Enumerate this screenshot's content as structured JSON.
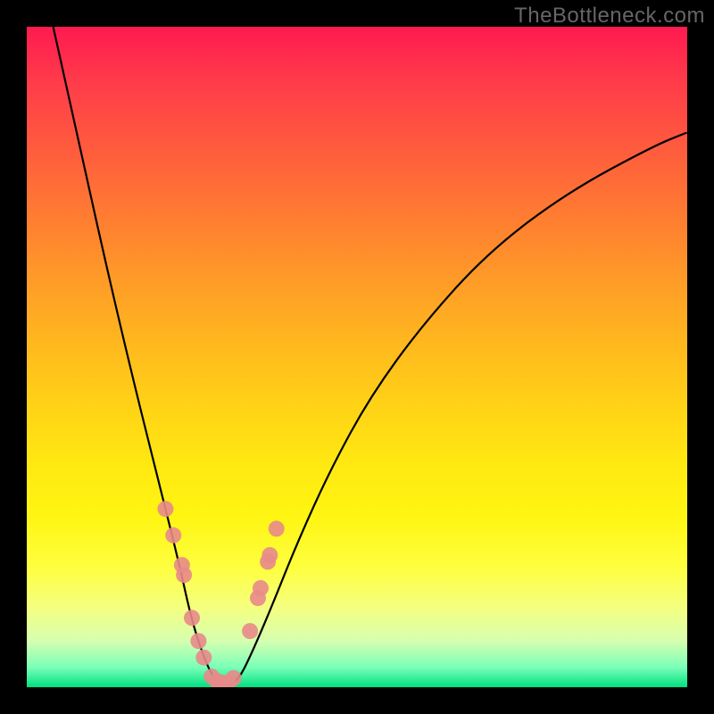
{
  "watermark": "TheBottleneck.com",
  "chart_data": {
    "type": "line",
    "title": "",
    "xlabel": "",
    "ylabel": "",
    "xlim": [
      0,
      100
    ],
    "ylim": [
      0,
      100
    ],
    "background_gradient": [
      "#ff1a50",
      "#ff7a32",
      "#ffd416",
      "#feff40",
      "#00e080"
    ],
    "series": [
      {
        "name": "curve",
        "x": [
          4,
          8,
          12,
          16,
          20,
          23,
          25,
          27,
          28.5,
          30,
          32,
          34,
          37,
          41,
          46,
          52,
          60,
          70,
          82,
          95,
          100
        ],
        "y": [
          100,
          82,
          64,
          47,
          31,
          19,
          10,
          4,
          1,
          0,
          1,
          5,
          12,
          22,
          33,
          44,
          55,
          66,
          75,
          82,
          84
        ]
      }
    ],
    "markers": {
      "name": "dots",
      "color": "#e88a8a",
      "x": [
        21.0,
        22.2,
        23.5,
        23.8,
        25.0,
        26.0,
        26.8,
        28.0,
        28.8,
        29.5,
        30.5,
        31.3,
        33.8,
        35.0,
        35.4,
        36.5,
        36.8,
        37.8
      ],
      "y": [
        27.0,
        23.0,
        18.5,
        17.0,
        10.5,
        7.0,
        4.5,
        1.6,
        0.9,
        0.7,
        0.7,
        1.4,
        8.5,
        13.5,
        15.0,
        19.0,
        20.0,
        24.0
      ]
    }
  }
}
